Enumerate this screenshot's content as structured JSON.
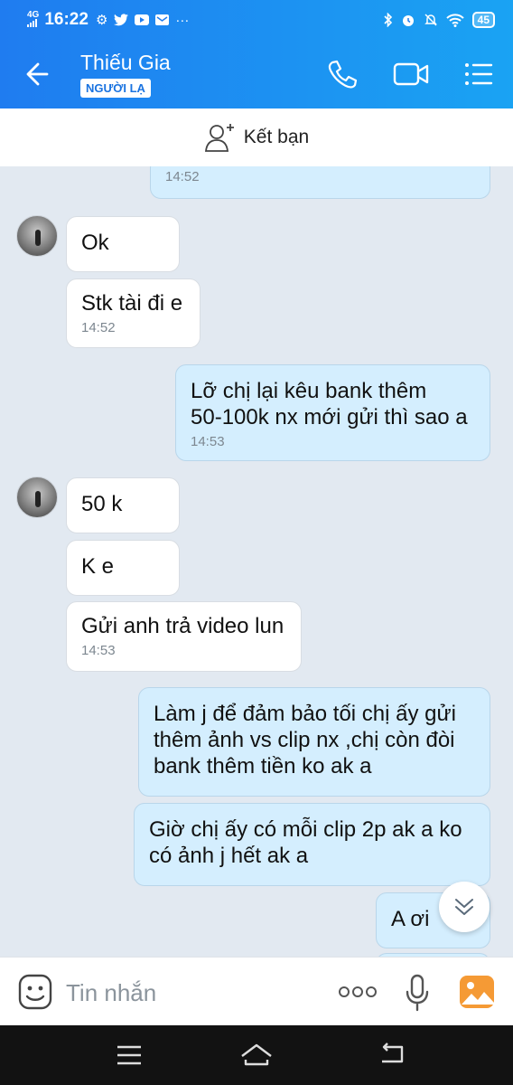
{
  "status_bar": {
    "network": "4G",
    "time": "16:22",
    "battery": "45",
    "left_icons": [
      "gear-icon",
      "twitter-icon",
      "youtube-icon",
      "mail-icon",
      "more-dots-icon"
    ],
    "right_icons": [
      "bluetooth-icon",
      "alarm-icon",
      "mute-icon",
      "wifi-icon",
      "battery-icon"
    ]
  },
  "header": {
    "name": "Thiếu Gia",
    "badge": "NGƯỜI LẠ",
    "accent": "#1f7cf0"
  },
  "friend_bar": {
    "label": "Kết bạn"
  },
  "messages": [
    {
      "side": "out",
      "time": "14:52"
    },
    {
      "side": "in",
      "text": "Ok"
    },
    {
      "side": "in",
      "text": "Stk tài đi e",
      "time": "14:52"
    },
    {
      "side": "out",
      "lines": [
        "Lỡ chị lại kêu bank thêm",
        "50-100k nx mới gửi thì sao a"
      ],
      "time": "14:53"
    },
    {
      "side": "in",
      "text": "50 k"
    },
    {
      "side": "in",
      "text": "K e"
    },
    {
      "side": "in",
      "text": "Gửi anh trả video lun",
      "time": "14:53"
    },
    {
      "side": "out",
      "lines": [
        "Làm j để đảm bảo tối chị ấy gửi",
        "thêm ảnh vs clip nx ,chị còn đòi",
        "bank thêm tiền ko ak a"
      ]
    },
    {
      "side": "out",
      "lines": [
        "Giờ chị ấy có mỗi clip 2p ak a ko",
        "có ảnh j hết ak a"
      ]
    },
    {
      "side": "out",
      "text": "A ơi"
    }
  ],
  "input": {
    "placeholder": "Tin nhắn"
  }
}
